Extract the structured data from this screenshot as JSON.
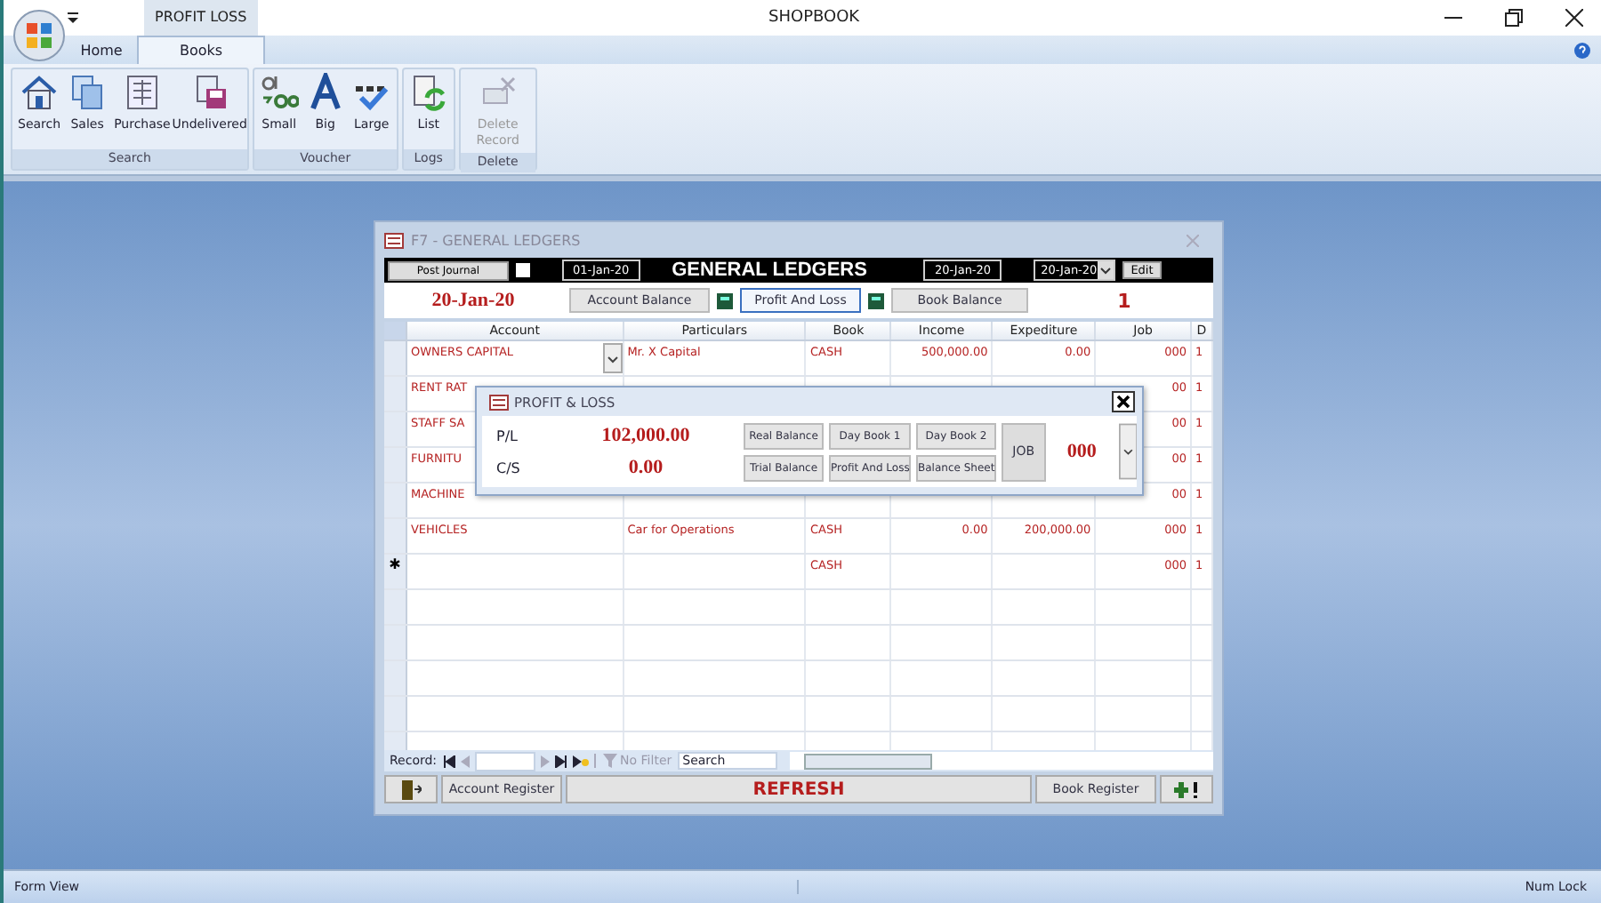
{
  "window": {
    "title": "SHOPBOOK",
    "context_tab": "PROFIT  LOSS"
  },
  "tabs": [
    {
      "label": "Home",
      "selected": false
    },
    {
      "label": "Books",
      "selected": true
    }
  ],
  "ribbon": [
    {
      "label": "Search",
      "buttons": [
        {
          "label": "Search",
          "disabled": false
        },
        {
          "label": "Sales",
          "disabled": false
        },
        {
          "label": "Purchase",
          "disabled": false
        },
        {
          "label": "Undelivered",
          "disabled": false
        }
      ]
    },
    {
      "label": "Voucher",
      "buttons": [
        {
          "label": "Small",
          "disabled": false
        },
        {
          "label": "Big",
          "disabled": false
        },
        {
          "label": "Large",
          "disabled": false
        }
      ]
    },
    {
      "label": "Logs",
      "buttons": [
        {
          "label": "List",
          "disabled": false
        }
      ]
    },
    {
      "label": "Delete",
      "buttons": [
        {
          "label": "Delete Record",
          "disabled": true
        }
      ]
    }
  ],
  "ledger": {
    "title": "F7 - GENERAL LEDGERS",
    "post_journal": "Post Journal",
    "checked": false,
    "date_from": "01-Jan-20",
    "heading": "GENERAL LEDGERS",
    "date_to": "20-Jan-20",
    "date_combo": "20-Jan-20",
    "edit": "Edit",
    "current_date": "20-Jan-20",
    "buttons": [
      {
        "label": "Account Balance",
        "selected": false
      },
      {
        "label": "Profit And Loss",
        "selected": true
      },
      {
        "label": "Book Balance",
        "selected": false
      }
    ],
    "count": "1",
    "columns": [
      "Account",
      "Particulars",
      "Book",
      "Income",
      "Expediture",
      "Job",
      "D"
    ],
    "rows": [
      {
        "kind": "record",
        "dropdown": true,
        "cells": [
          "OWNERS CAPITAL",
          "Mr. X Capital",
          "CASH",
          "500,000.00",
          "0.00",
          "000",
          "1"
        ]
      },
      {
        "kind": "record",
        "dropdown": false,
        "cells": [
          "RENT RAT",
          "",
          "",
          "",
          "",
          "00",
          "1"
        ]
      },
      {
        "kind": "record",
        "dropdown": false,
        "cells": [
          "STAFF SA",
          "",
          "",
          "",
          "",
          "00",
          "1"
        ]
      },
      {
        "kind": "record",
        "dropdown": false,
        "cells": [
          "FURNITU",
          "",
          "",
          "",
          "",
          "00",
          "1"
        ]
      },
      {
        "kind": "record",
        "dropdown": false,
        "cells": [
          "MACHINE",
          "",
          "",
          "",
          "",
          "00",
          "1"
        ]
      },
      {
        "kind": "record",
        "dropdown": false,
        "cells": [
          "VEHICLES",
          "Car for Operations",
          "CASH",
          "0.00",
          "200,000.00",
          "000",
          "1"
        ]
      },
      {
        "kind": "new",
        "marker": "✱",
        "dropdown": false,
        "cells": [
          "",
          "",
          "CASH",
          "",
          "",
          "000",
          "1"
        ]
      }
    ],
    "navigation": {
      "label": "Record:",
      "filter": "No Filter",
      "search": "Search"
    },
    "bottom": {
      "account_register": "Account Register",
      "refresh": "REFRESH",
      "book_register": "Book Register"
    }
  },
  "popup": {
    "title": "PROFIT & LOSS",
    "pl_label": "P/L",
    "pl_value": "102,000.00",
    "cs_label": "C/S",
    "cs_value": "0.00",
    "buttons": [
      "Real Balance",
      "Day Book 1",
      "Day Book 2",
      "Trial Balance",
      "Profit And Loss",
      "Balance Sheet"
    ],
    "job_label": "JOB",
    "job_value": "000"
  },
  "status_bar": {
    "left": "Form View",
    "right": "Num Lock"
  }
}
